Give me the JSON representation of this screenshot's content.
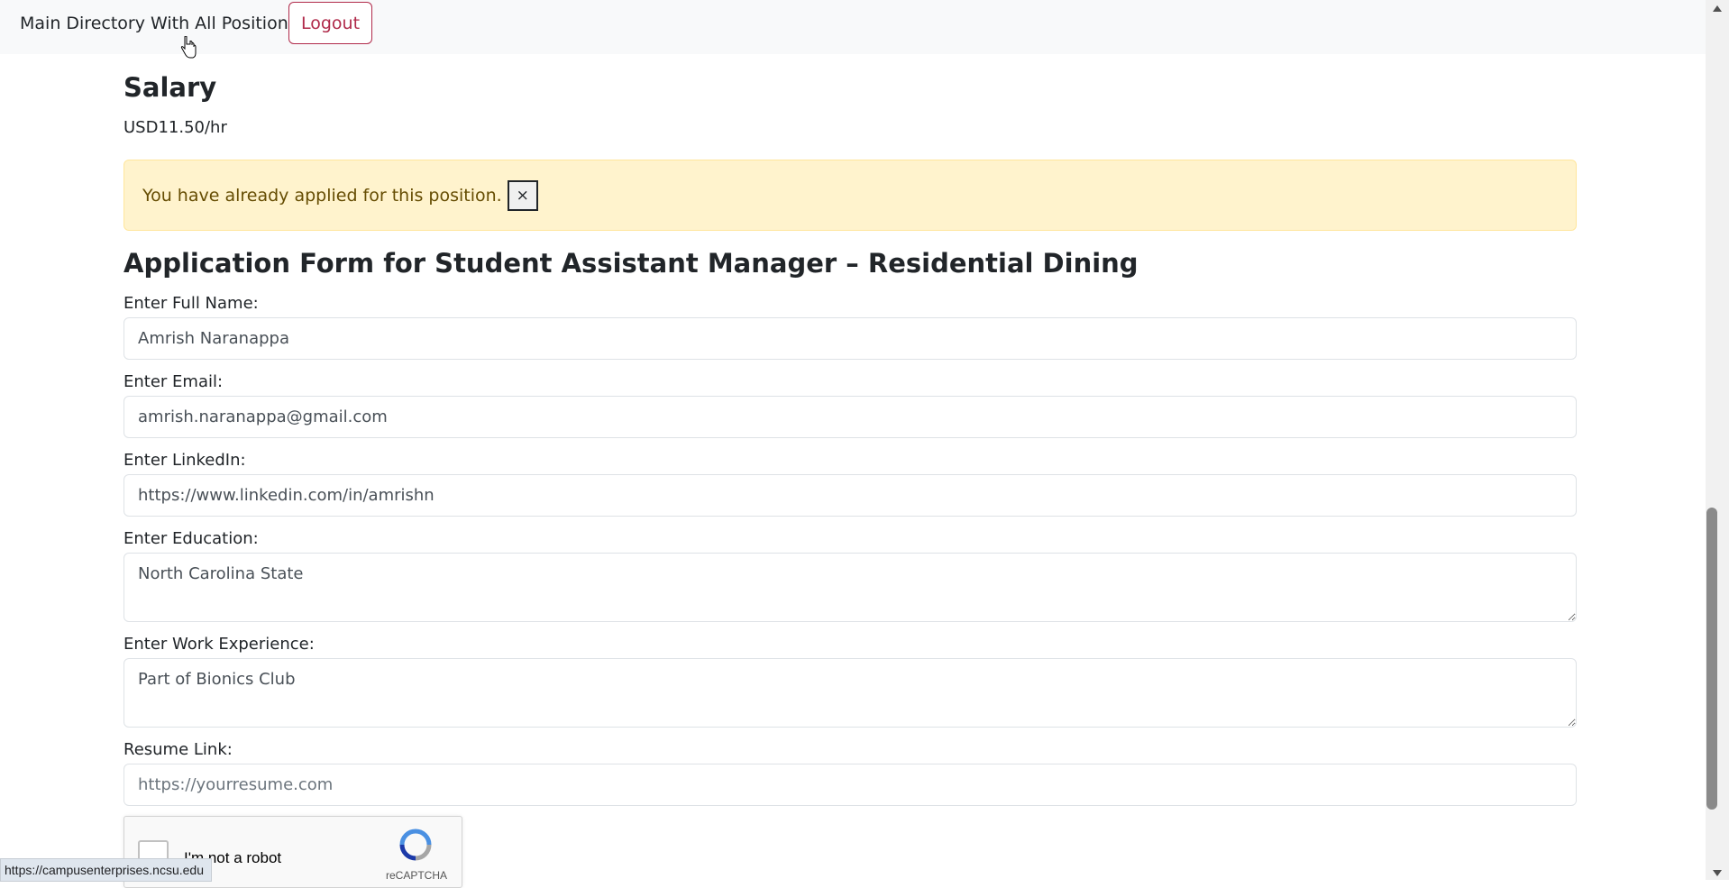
{
  "nav": {
    "directory_link": "Main Directory With All Positions",
    "logout_label": "Logout"
  },
  "salary": {
    "heading": "Salary",
    "value": "USD11.50/hr"
  },
  "alert": {
    "message": "You have already applied for this position.",
    "close_label": "×"
  },
  "form": {
    "title": "Application Form for Student Assistant Manager – Residential Dining",
    "full_name": {
      "label": "Enter Full Name:",
      "value": "Amrish Naranappa"
    },
    "email": {
      "label": "Enter Email:",
      "value": "amrish.naranappa@gmail.com"
    },
    "linkedin": {
      "label": "Enter LinkedIn:",
      "value": "https://www.linkedin.com/in/amrishn"
    },
    "education": {
      "label": "Enter Education:",
      "value": "North Carolina State"
    },
    "work_experience": {
      "label": "Enter Work Experience:",
      "value": "Part of Bionics Club"
    },
    "resume": {
      "label": "Resume Link:",
      "placeholder": "https://yourresume.com"
    }
  },
  "recaptcha": {
    "label": "I'm not a robot",
    "brand": "reCAPTCHA"
  },
  "status_bar": {
    "url": "https://campusenterprises.ncsu.edu"
  },
  "colors": {
    "accent": "#b02a4a",
    "alert_bg": "#fff3cd",
    "alert_text": "#664d03",
    "navbar_bg": "#f8f9fa"
  }
}
